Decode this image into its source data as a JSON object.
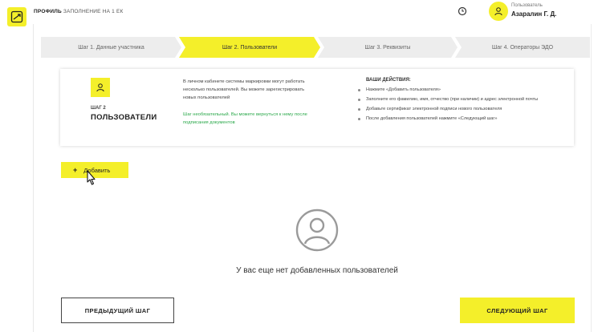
{
  "header": {
    "brand_prefix": "ПРОФИЛЬ",
    "brand_suffix": "ЗАПОЛНЕНИЕ НА 1 ЕК",
    "user_label": "Пользователь",
    "user_name": "Азаралин Г. Д."
  },
  "steps": [
    {
      "label": "Шаг 1. Данные участника",
      "active": false
    },
    {
      "label": "Шаг 2. Пользователи",
      "active": true
    },
    {
      "label": "Шаг 3. Реквизиты",
      "active": false
    },
    {
      "label": "Шаг 4. Операторы ЭДО",
      "active": false
    }
  ],
  "card": {
    "step_no": "ШАГ 2",
    "step_title": "ПОЛЬЗОВАТЕЛИ",
    "intro": "В личном кабинете системы маркировки могут работать несколько пользователей. Вы можете зарегистрировать новых пользователей",
    "note": "Шаг необязательный. Вы можете вернуться к нему после подписания документов",
    "actions_title": "ВАШИ ДЕЙСТВИЯ:",
    "actions": [
      "Нажмите «Добавить пользователя»",
      "Заполните его фамилию, имя, отчество (при наличии) и адрес электронной почты",
      "Добавьте сертификат электронной подписи нового пользователя",
      "После добавления пользователей нажмите «Следующий шаг»"
    ]
  },
  "add_button": {
    "plus": "+",
    "label": "Добавить"
  },
  "empty_state": {
    "text": "У вас еще нет добавленных пользователей"
  },
  "footer": {
    "prev_label": "ПРЕДЫДУЩИЙ ШАГ",
    "next_label": "СЛЕДУЮЩИЙ ШАГ"
  },
  "colors": {
    "accent": "#f4ef2a",
    "note_green": "#2aa84a"
  },
  "icons": [
    "logo-icon",
    "clock-icon",
    "user-icon",
    "cursor-icon",
    "empty-user-icon"
  ]
}
